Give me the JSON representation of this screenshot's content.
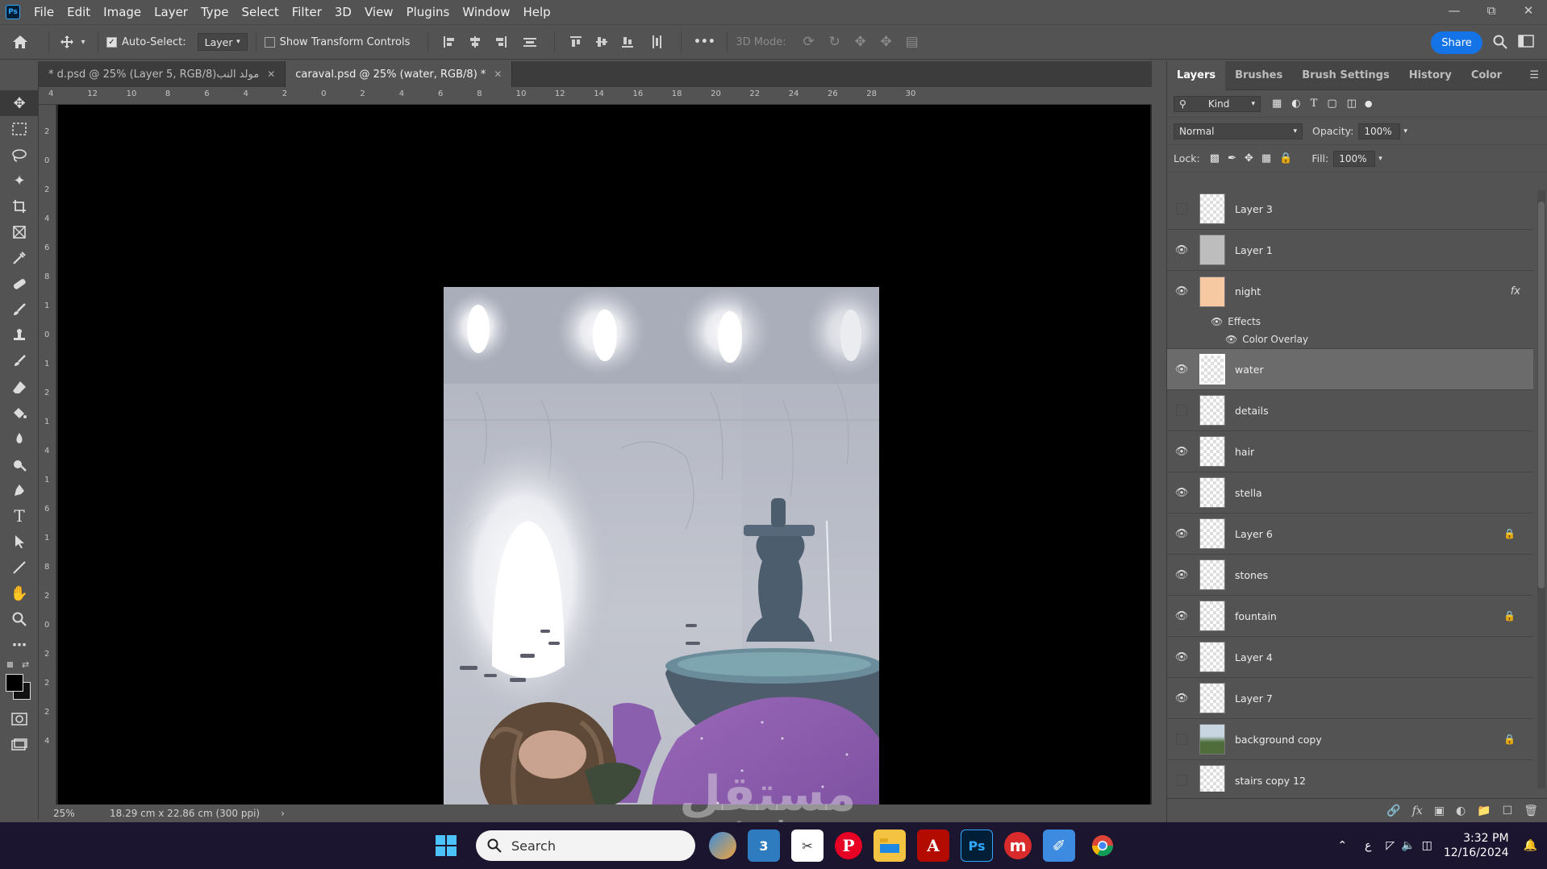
{
  "app": {
    "logo": "Ps",
    "menu": [
      "File",
      "Edit",
      "Image",
      "Layer",
      "Type",
      "Select",
      "Filter",
      "3D",
      "View",
      "Plugins",
      "Window",
      "Help"
    ]
  },
  "options_bar": {
    "auto_select_label": "Auto-Select:",
    "auto_select_value": "Layer",
    "show_transform_label": "Show Transform Controls",
    "mode_3d_label": "3D Mode:",
    "more_label": "•••",
    "share_label": "Share"
  },
  "tabs": [
    {
      "label": "مولد النبd.psd @ 25% (Layer 5, RGB/8) *",
      "active": false
    },
    {
      "label": "caraval.psd @ 25% (water, RGB/8) *",
      "active": true
    }
  ],
  "tools": [
    "move-tool",
    "marquee-tool",
    "lasso-tool",
    "magic-wand-tool",
    "crop-tool",
    "frame-tool",
    "eyedropper-tool",
    "healing-tool",
    "brush-tool",
    "stamp-tool",
    "history-brush-tool",
    "eraser-tool",
    "bucket-tool",
    "blur-tool",
    "dodge-tool",
    "pen-tool",
    "type-tool",
    "path-select-tool",
    "line-tool",
    "hand-tool",
    "zoom-tool",
    "more-tools"
  ],
  "ruler_top": [
    "4",
    "12",
    "10",
    "8",
    "6",
    "4",
    "2",
    "0",
    "2",
    "4",
    "6",
    "8",
    "10",
    "12",
    "14",
    "16",
    "18",
    "20",
    "22",
    "24",
    "26",
    "28",
    "30"
  ],
  "ruler_left": [
    "2",
    "0",
    "2",
    "4",
    "6",
    "8",
    "1",
    "0",
    "1",
    "2",
    "1",
    "4",
    "1",
    "6",
    "1",
    "8",
    "2",
    "0",
    "2",
    "2",
    "2",
    "4"
  ],
  "status": {
    "zoom": "25%",
    "doc_size": "18.29 cm x 22.86 cm (300 ppi)",
    "arrow": "›"
  },
  "panel": {
    "tabs": [
      "Layers",
      "Brushes",
      "Brush Settings",
      "History",
      "Color"
    ],
    "filter_kind": "Kind",
    "blend_mode": "Normal",
    "opacity_label": "Opacity:",
    "opacity_value": "100%",
    "lock_label": "Lock:",
    "fill_label": "Fill:",
    "fill_value": "100%",
    "layers": [
      {
        "name": "Layer 3",
        "visible": false,
        "locked": false
      },
      {
        "name": "Layer 1",
        "visible": true,
        "locked": false
      },
      {
        "name": "night",
        "visible": true,
        "locked": false,
        "fx": "fx",
        "thumb_color": "#f7c9a2"
      },
      {
        "name": "water",
        "visible": true,
        "locked": false,
        "selected": true
      },
      {
        "name": "details",
        "visible": false,
        "locked": false
      },
      {
        "name": "hair",
        "visible": true,
        "locked": false
      },
      {
        "name": "stella",
        "visible": true,
        "locked": false
      },
      {
        "name": "Layer 6",
        "visible": true,
        "locked": true
      },
      {
        "name": "stones",
        "visible": true,
        "locked": false
      },
      {
        "name": "fountain",
        "visible": true,
        "locked": true
      },
      {
        "name": "Layer 4",
        "visible": true,
        "locked": false
      },
      {
        "name": "Layer 7",
        "visible": true,
        "locked": false
      },
      {
        "name": "background copy",
        "visible": false,
        "locked": true
      },
      {
        "name": "stairs copy 12",
        "visible": false,
        "locked": false
      }
    ],
    "effects_label": "Effects",
    "color_overlay_label": "Color Overlay"
  },
  "taskbar": {
    "search_placeholder": "Search",
    "time": "3:32 PM",
    "date": "12/16/2024",
    "lang": "ع"
  },
  "watermark": {
    "text": "مستقل",
    "sub": "mostaql.com"
  },
  "colors": {
    "accent": "#1473e6",
    "ps_blue": "#31a8ff",
    "panel_bg": "#535353",
    "canvas_bg": "#000000"
  }
}
